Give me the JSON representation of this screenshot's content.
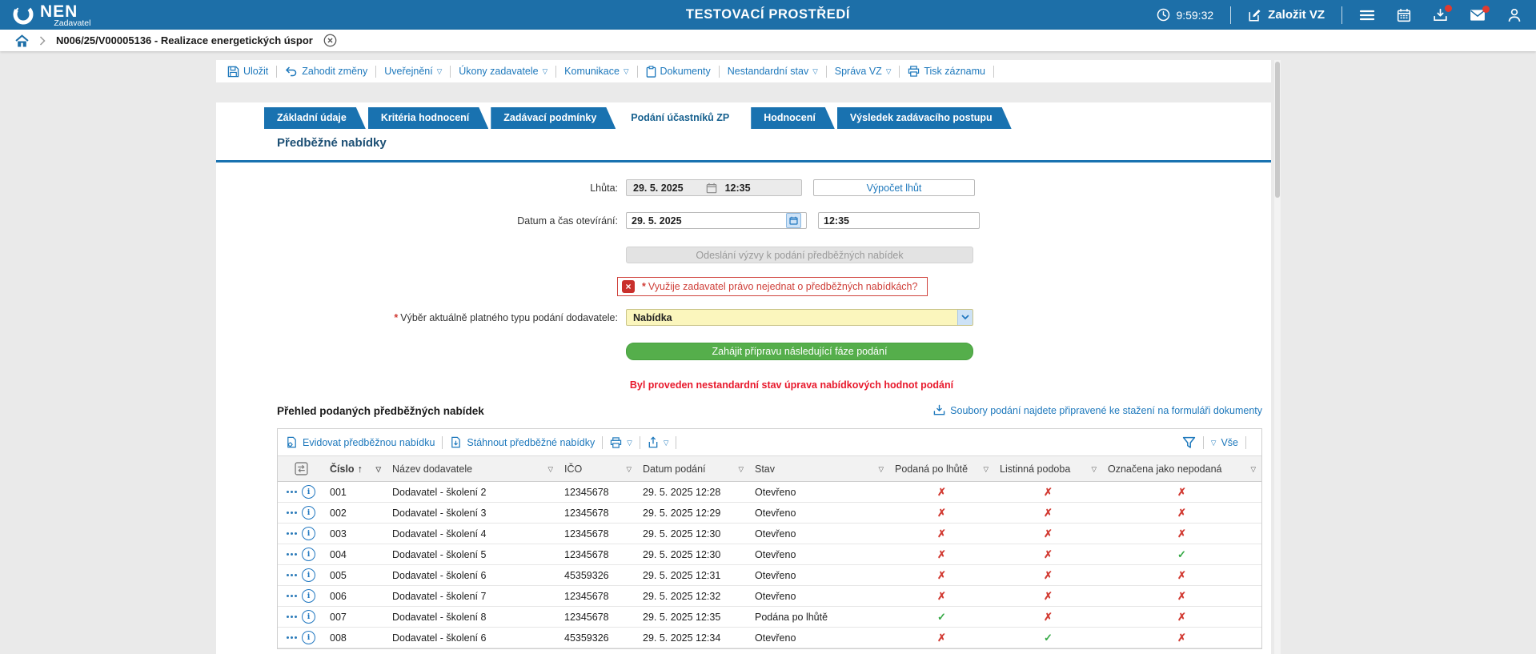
{
  "header": {
    "brand": "NEN",
    "brand_sub": "Zadavatel",
    "env_title": "TESTOVACÍ PROSTŘEDÍ",
    "time": "9:59:32",
    "create_vz": "Založit VZ"
  },
  "breadcrumb": {
    "title": "N006/25/V00005136 - Realizace energetických úspor"
  },
  "actionbar": {
    "items": [
      {
        "label": "Uložit"
      },
      {
        "label": "Zahodit změny"
      },
      {
        "label": "Uveřejnění",
        "dropdown": true
      },
      {
        "label": "Úkony zadavatele",
        "dropdown": true
      },
      {
        "label": "Komunikace",
        "dropdown": true
      },
      {
        "label": "Dokumenty"
      },
      {
        "label": "Nestandardní stav",
        "dropdown": true
      },
      {
        "label": "Správa VZ",
        "dropdown": true
      },
      {
        "label": "Tisk záznamu"
      }
    ]
  },
  "tabs": [
    {
      "label": "Základní údaje",
      "active": false
    },
    {
      "label": "Kritéria hodnocení",
      "active": false
    },
    {
      "label": "Zadávací podmínky",
      "active": false
    },
    {
      "label": "Podání účastníků ZP",
      "active": true
    },
    {
      "label": "Hodnocení",
      "active": false
    },
    {
      "label": "Výsledek zadávacího postupu",
      "active": false
    }
  ],
  "section": {
    "title": "Předběžné nabídky"
  },
  "form": {
    "lhuta_label": "Lhůta:",
    "lhuta_date": "29. 5. 2025",
    "lhuta_time": "12:35",
    "vypocet_btn": "Výpočet lhůt",
    "otevirani_label": "Datum a čas otevírání:",
    "otevirani_date": "29. 5. 2025",
    "otevirani_time": "12:35",
    "odeslani_btn": "Odeslání výzvy k podání předběžných nabídek",
    "question_required": "*",
    "question": "Využije zadavatel právo nejednat o předběžných nabídkách?",
    "vyber_required": "*",
    "vyber_label": "Výběr aktuálně platného typu podání dodavatele:",
    "vyber_value": "Nabídka",
    "zahajit_btn": "Zahájit přípravu následující fáze podání",
    "warning": "Byl proveden nestandardní stav úprava nabídkových hodnot podání"
  },
  "table_section": {
    "title": "Přehled podaných předběžných nabídek",
    "download_link": "Soubory podání najdete připravené ke stažení na formuláři dokumenty",
    "action_evidovat": "Evidovat předběžnou nabídku",
    "action_stahnout": "Stáhnout předběžné nabídky",
    "filter_all": "Vše",
    "columns": [
      "Číslo",
      "Název dodavatele",
      "IČO",
      "Datum podání",
      "Stav",
      "Podaná po lhůtě",
      "Listinná podoba",
      "Označena jako nepodaná"
    ],
    "rows": [
      {
        "cislo": "001",
        "nazev": "Dodavatel - školení 2",
        "ico": "12345678",
        "datum": "29. 5. 2025 12:28",
        "stav": "Otevřeno",
        "po_lhute": "x",
        "listinna": "x",
        "nepodana": "x"
      },
      {
        "cislo": "002",
        "nazev": "Dodavatel - školení 3",
        "ico": "12345678",
        "datum": "29. 5. 2025 12:29",
        "stav": "Otevřeno",
        "po_lhute": "x",
        "listinna": "x",
        "nepodana": "x"
      },
      {
        "cislo": "003",
        "nazev": "Dodavatel - školení 4",
        "ico": "12345678",
        "datum": "29. 5. 2025 12:30",
        "stav": "Otevřeno",
        "po_lhute": "x",
        "listinna": "x",
        "nepodana": "x"
      },
      {
        "cislo": "004",
        "nazev": "Dodavatel - školení 5",
        "ico": "12345678",
        "datum": "29. 5. 2025 12:30",
        "stav": "Otevřeno",
        "po_lhute": "x",
        "listinna": "x",
        "nepodana": "check"
      },
      {
        "cislo": "005",
        "nazev": "Dodavatel - školení 6",
        "ico": "45359326",
        "datum": "29. 5. 2025 12:31",
        "stav": "Otevřeno",
        "po_lhute": "x",
        "listinna": "x",
        "nepodana": "x"
      },
      {
        "cislo": "006",
        "nazev": "Dodavatel - školení 7",
        "ico": "12345678",
        "datum": "29. 5. 2025 12:32",
        "stav": "Otevřeno",
        "po_lhute": "x",
        "listinna": "x",
        "nepodana": "x"
      },
      {
        "cislo": "007",
        "nazev": "Dodavatel - školení 8",
        "ico": "12345678",
        "datum": "29. 5. 2025 12:35",
        "stav": "Podána po lhůtě",
        "po_lhute": "check",
        "listinna": "x",
        "nepodana": "x"
      },
      {
        "cislo": "008",
        "nazev": "Dodavatel - školení 6",
        "ico": "45359326",
        "datum": "29. 5. 2025 12:34",
        "stav": "Otevřeno",
        "po_lhute": "x",
        "listinna": "check",
        "nepodana": "x"
      }
    ]
  },
  "colors": {
    "header_blue": "#1d6fa8",
    "tab_blue": "#1972b0",
    "link_blue": "#1d78bc",
    "green_button": "#55ae4b",
    "red": "#d23b33",
    "green_check": "#35a945",
    "warning_red": "#e8192c",
    "yellow_field": "#fbf6bd"
  }
}
